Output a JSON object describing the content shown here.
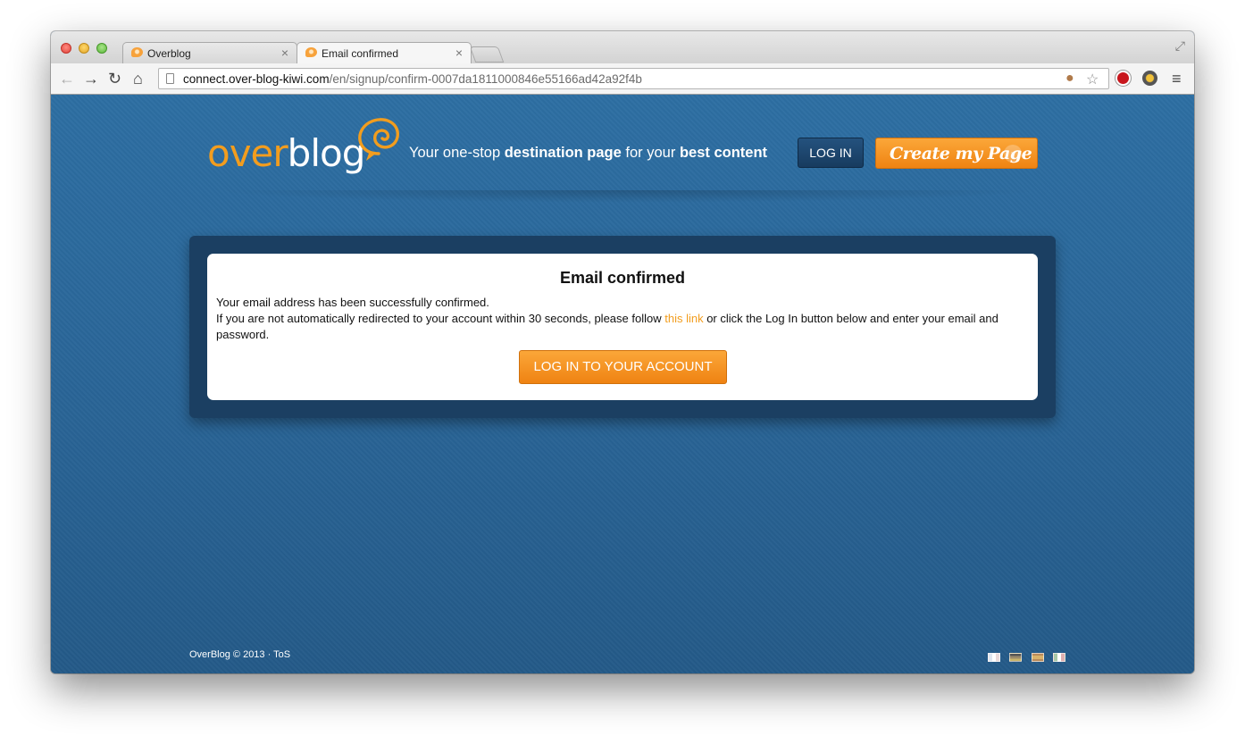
{
  "browser": {
    "tabs": [
      {
        "label": "Overblog",
        "active": false
      },
      {
        "label": "Email confirmed",
        "active": true
      }
    ],
    "tab_close_glyph": "×",
    "address": {
      "host": "connect.over-blog-kiwi.com",
      "path": "/en/signup/confirm-0007da1811000846e55166ad42a92f4b"
    },
    "icons": {
      "back": "back-arrow-icon",
      "forward": "forward-arrow-icon",
      "reload": "reload-icon",
      "home": "home-icon",
      "page": "page-icon",
      "cookie": "blocked-cookie-icon",
      "bookmark": "bookmark-star-icon",
      "adblock": "adblock-icon",
      "extension": "extension-icon",
      "menu": "menu-icon",
      "fullscreen": "fullscreen-icon"
    }
  },
  "header": {
    "logo_over": "over",
    "logo_blog": "blog",
    "tagline": {
      "part1": "Your one-stop ",
      "bold1": "destination page",
      "part2": " for your ",
      "bold2": "best content"
    },
    "login_label": "LOG IN",
    "create_label": "Create my Page",
    "create_arrow": "›"
  },
  "main": {
    "title": "Email confirmed",
    "line1": "Your email address has been successfully confirmed.",
    "line2_before": "If you are not automatically redirected to your account within 30 seconds, please follow ",
    "link_text": "this link",
    "line2_after": " or click the Log In button below and enter your email and password.",
    "button_label": "LOG IN TO YOUR ACCOUNT"
  },
  "footer": {
    "copyright": "OverBlog © 2013",
    "separator": " · ",
    "tos": "ToS",
    "languages": [
      "flag-fr-icon",
      "flag-de-icon",
      "flag-es-icon",
      "flag-it-icon"
    ]
  },
  "colors": {
    "page_bg": "#2c6a9e",
    "panel_frame": "#1b3f62",
    "accent_orange": "#f29d1e",
    "login_button": "#1d4670"
  }
}
